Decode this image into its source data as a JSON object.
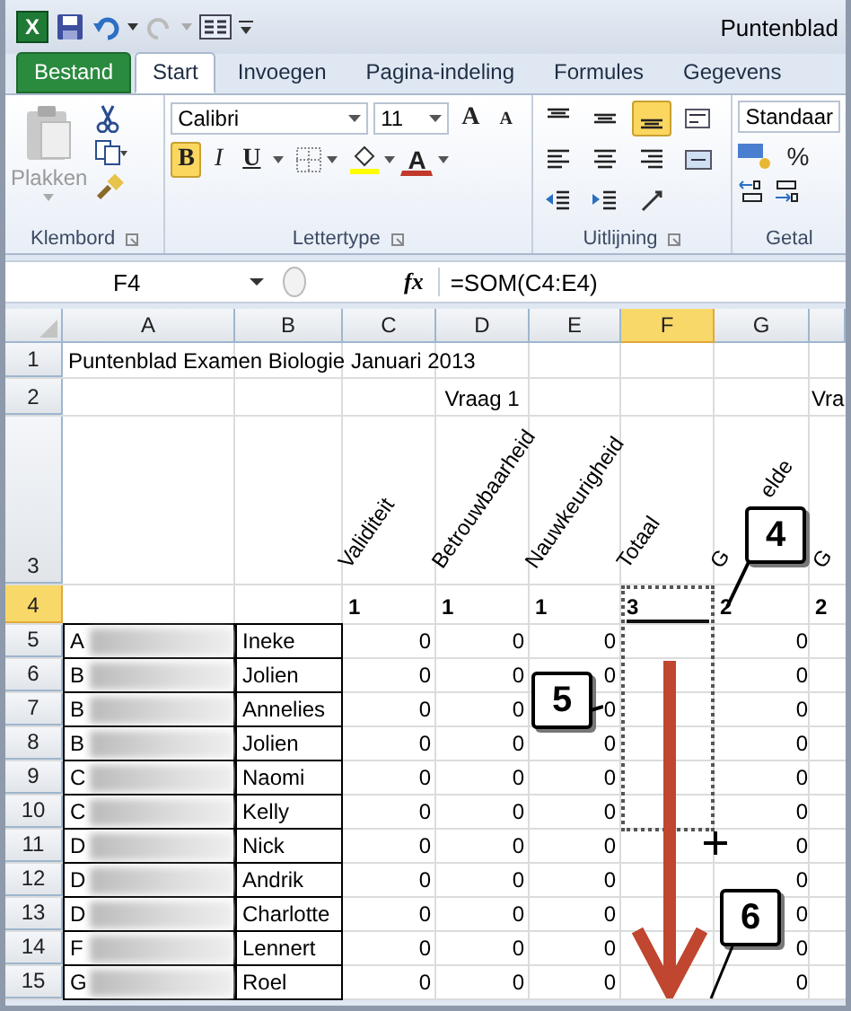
{
  "window": {
    "app_logo": "X",
    "title": "Puntenblad"
  },
  "tabs": [
    {
      "label": "Bestand",
      "kind": "file",
      "selected": false
    },
    {
      "label": "Start",
      "kind": "tab",
      "selected": true
    },
    {
      "label": "Invoegen",
      "kind": "tab",
      "selected": false
    },
    {
      "label": "Pagina-indeling",
      "kind": "tab",
      "selected": false
    },
    {
      "label": "Formules",
      "kind": "tab",
      "selected": false
    },
    {
      "label": "Gegevens",
      "kind": "tab",
      "selected": false
    }
  ],
  "clipboard": {
    "paste_label": "Plakken",
    "paste_disabled": true,
    "group_label": "Klembord"
  },
  "font": {
    "name": "Calibri",
    "size": "11",
    "grow": "A",
    "shrink": "A",
    "font_color_label": "A",
    "group_label": "Lettertype",
    "styles": [
      {
        "kind": "bold",
        "label": "B",
        "selected": true
      },
      {
        "kind": "italic",
        "label": "I",
        "selected": false
      },
      {
        "kind": "underline",
        "label": "U",
        "selected": false
      }
    ]
  },
  "alignment": {
    "group_label": "Uitlijning",
    "buttons": [
      {
        "kind": "top",
        "selected": false
      },
      {
        "kind": "middle",
        "selected": false
      },
      {
        "kind": "bottom",
        "selected": true
      },
      {
        "kind": "wrap",
        "selected": false
      },
      {
        "kind": "left",
        "selected": false
      },
      {
        "kind": "center",
        "selected": false
      },
      {
        "kind": "right",
        "selected": false
      },
      {
        "kind": "merge",
        "selected": false
      },
      {
        "kind": "outdent",
        "selected": false
      },
      {
        "kind": "indent",
        "selected": false
      },
      {
        "kind": "orientation",
        "selected": false
      }
    ]
  },
  "number": {
    "format": "Standaar",
    "percent": "%",
    "group_label": "Getal"
  },
  "formula_bar": {
    "name_box": "F4",
    "fx": "fx",
    "formula": "=SOM(C4:E4)"
  },
  "columns": [
    {
      "label": "A",
      "selected": false
    },
    {
      "label": "B",
      "selected": false
    },
    {
      "label": "C",
      "selected": false
    },
    {
      "label": "D",
      "selected": false
    },
    {
      "label": "E",
      "selected": false
    },
    {
      "label": "F",
      "selected": true
    },
    {
      "label": "G",
      "selected": false
    }
  ],
  "rows": [
    {
      "number": "1",
      "selected": false,
      "kind": "title",
      "text": "Puntenblad Examen Biologie Januari 2013"
    },
    {
      "number": "2",
      "selected": false,
      "kind": "group",
      "text": "Vraag 1",
      "next_group": "Vra"
    },
    {
      "number": "3",
      "selected": false,
      "kind": "headers",
      "cells": [
        "Validiteit",
        "Betrouwbaarheid",
        "Nauwkeurigheid",
        "Totaal",
        "G",
        "G"
      ],
      "covered_tail": "elde"
    },
    {
      "number": "4",
      "selected": true,
      "kind": "weights",
      "cells": [
        "1",
        "1",
        "1",
        "3",
        "2",
        "2"
      ]
    },
    {
      "number": "5",
      "selected": false,
      "kind": "student",
      "initial": "A",
      "first_name": "Ineke",
      "scores": [
        "0",
        "0",
        "0"
      ],
      "next": "0"
    },
    {
      "number": "6",
      "selected": false,
      "kind": "student",
      "initial": "B",
      "first_name": "Jolien",
      "scores": [
        "0",
        "0",
        "0"
      ],
      "next": "0"
    },
    {
      "number": "7",
      "selected": false,
      "kind": "student",
      "initial": "B",
      "first_name": "Annelies",
      "scores": [
        "0",
        "0",
        "0"
      ],
      "next": "0"
    },
    {
      "number": "8",
      "selected": false,
      "kind": "student",
      "initial": "B",
      "first_name": "Jolien",
      "scores": [
        "0",
        "0",
        "0"
      ],
      "next": "0"
    },
    {
      "number": "9",
      "selected": false,
      "kind": "student",
      "initial": "C",
      "first_name": "Naomi",
      "scores": [
        "0",
        "0",
        "0"
      ],
      "next": "0"
    },
    {
      "number": "10",
      "selected": false,
      "kind": "student",
      "initial": "C",
      "first_name": "Kelly",
      "scores": [
        "0",
        "0",
        "0"
      ],
      "next": "0"
    },
    {
      "number": "11",
      "selected": false,
      "kind": "student",
      "initial": "D",
      "first_name": "Nick",
      "scores": [
        "0",
        "0",
        "0"
      ],
      "next": "0"
    },
    {
      "number": "12",
      "selected": false,
      "kind": "student",
      "initial": "D",
      "first_name": "Andrik",
      "scores": [
        "0",
        "0",
        "0"
      ],
      "next": "0"
    },
    {
      "number": "13",
      "selected": false,
      "kind": "student",
      "initial": "D",
      "first_name": "Charlotte",
      "scores": [
        "0",
        "0",
        "0"
      ],
      "next": "0"
    },
    {
      "number": "14",
      "selected": false,
      "kind": "student",
      "initial": "F",
      "first_name": "Lennert",
      "scores": [
        "0",
        "0",
        "0"
      ],
      "next": "0"
    },
    {
      "number": "15",
      "selected": false,
      "kind": "student",
      "initial": "G",
      "first_name": "Roel",
      "scores": [
        "0",
        "0",
        "0"
      ],
      "next": "0"
    }
  ],
  "callouts": [
    "4",
    "5",
    "6"
  ]
}
